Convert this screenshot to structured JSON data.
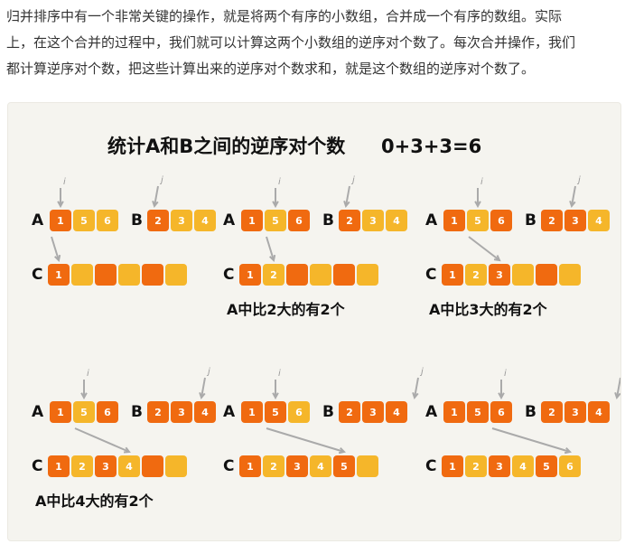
{
  "article": {
    "lines": [
      "归并排序中有一个非常关键的操作，就是将两个有序的小数组，合并成一个有序的数组。实际",
      "上，在这个合并的过程中，我们就可以计算这两个小数组的逆序对个数了。每次合并操作，我们",
      "都计算逆序对个数，把这些计算出来的逆序对个数求和，就是这个数组的逆序对个数了。"
    ]
  },
  "figure": {
    "title": "统计A和B之间的逆序对个数",
    "formula": "0+3+3=6",
    "label_a": "A",
    "label_b": "B",
    "label_c": "C",
    "pointer_i": "i",
    "pointer_j": "j",
    "array_a": [
      "1",
      "5",
      "6"
    ],
    "array_b": [
      "2",
      "3",
      "4"
    ],
    "steps": [
      {
        "c": [
          "1"
        ],
        "caption": ""
      },
      {
        "c": [
          "1",
          "2"
        ],
        "caption": "A中比2大的有2个"
      },
      {
        "c": [
          "1",
          "2",
          "3"
        ],
        "caption": "A中比3大的有2个"
      },
      {
        "c": [
          "1",
          "2",
          "3",
          "4"
        ],
        "caption": "A中比4大的有2个"
      },
      {
        "c": [
          "1",
          "2",
          "3",
          "4",
          "5"
        ],
        "caption": ""
      },
      {
        "c": [
          "1",
          "2",
          "3",
          "4",
          "5",
          "6"
        ],
        "caption": ""
      }
    ],
    "colors": {
      "orange": "#f06a10",
      "yellow": "#f5b62a",
      "background": "#f5f4ef"
    }
  }
}
